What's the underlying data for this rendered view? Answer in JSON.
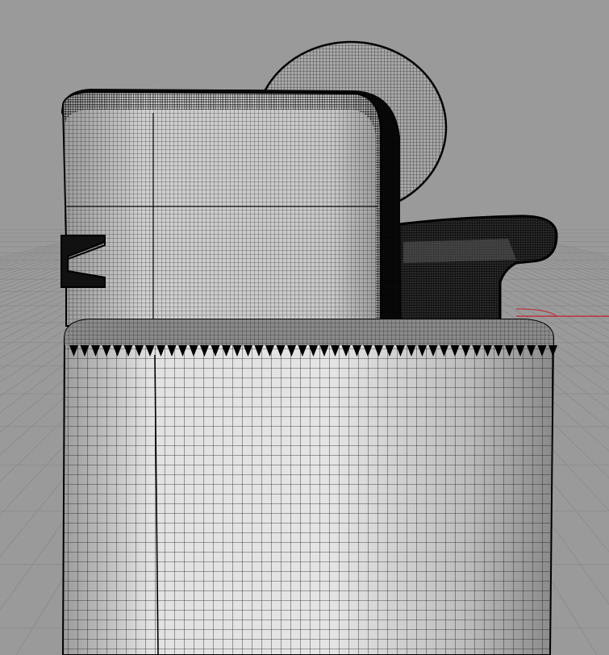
{
  "viewport": {
    "background_color": "#9a9a9a",
    "grid_color": "#8a8a8a",
    "axis_x_color": "#c0202a"
  },
  "model": {
    "subject": "lighter",
    "render_mode": "wireframe-shaded",
    "body_color": "#d8d8d8",
    "cap_color": "#bcbcbc",
    "wire_color": "#111111",
    "edge_color": "#000000"
  },
  "icons": []
}
